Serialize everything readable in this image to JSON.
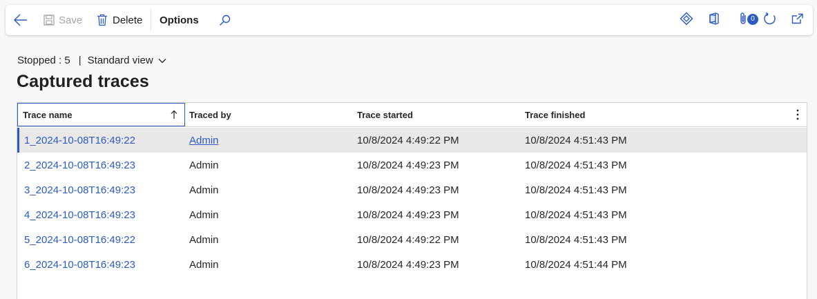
{
  "toolbar": {
    "save_label": "Save",
    "delete_label": "Delete",
    "options_label": "Options",
    "attachments_count": "0"
  },
  "view": {
    "status": "Stopped : 5",
    "separator": "|",
    "view_name": "Standard view"
  },
  "page_title": "Captured traces",
  "grid": {
    "columns": [
      "Trace name",
      "Traced by",
      "Trace started",
      "Trace finished"
    ],
    "rows": [
      {
        "name": "1_2024-10-08T16:49:22",
        "by": "Admin",
        "started": "10/8/2024 4:49:22 PM",
        "finished": "10/8/2024 4:51:43 PM"
      },
      {
        "name": "2_2024-10-08T16:49:23",
        "by": "Admin",
        "started": "10/8/2024 4:49:23 PM",
        "finished": "10/8/2024 4:51:43 PM"
      },
      {
        "name": "3_2024-10-08T16:49:23",
        "by": "Admin",
        "started": "10/8/2024 4:49:23 PM",
        "finished": "10/8/2024 4:51:43 PM"
      },
      {
        "name": "4_2024-10-08T16:49:23",
        "by": "Admin",
        "started": "10/8/2024 4:49:23 PM",
        "finished": "10/8/2024 4:51:43 PM"
      },
      {
        "name": "5_2024-10-08T16:49:22",
        "by": "Admin",
        "started": "10/8/2024 4:49:22 PM",
        "finished": "10/8/2024 4:51:43 PM"
      },
      {
        "name": "6_2024-10-08T16:49:23",
        "by": "Admin",
        "started": "10/8/2024 4:49:23 PM",
        "finished": "10/8/2024 4:51:44 PM"
      }
    ]
  },
  "icons": {
    "back": "back-arrow-icon",
    "save": "save-icon",
    "delete": "trash-icon",
    "search": "search-icon",
    "power_platform": "diamond-icon",
    "office": "office-icon",
    "attachments": "paperclip-icon",
    "refresh": "refresh-icon",
    "open_new": "open-new-window-icon",
    "sort": "sort-ascending-icon",
    "more": "more-options-icon"
  },
  "colors": {
    "accent": "#2a5bc0",
    "selected_row": "#e9e8e7",
    "disabled_text": "#a6a6a6"
  }
}
